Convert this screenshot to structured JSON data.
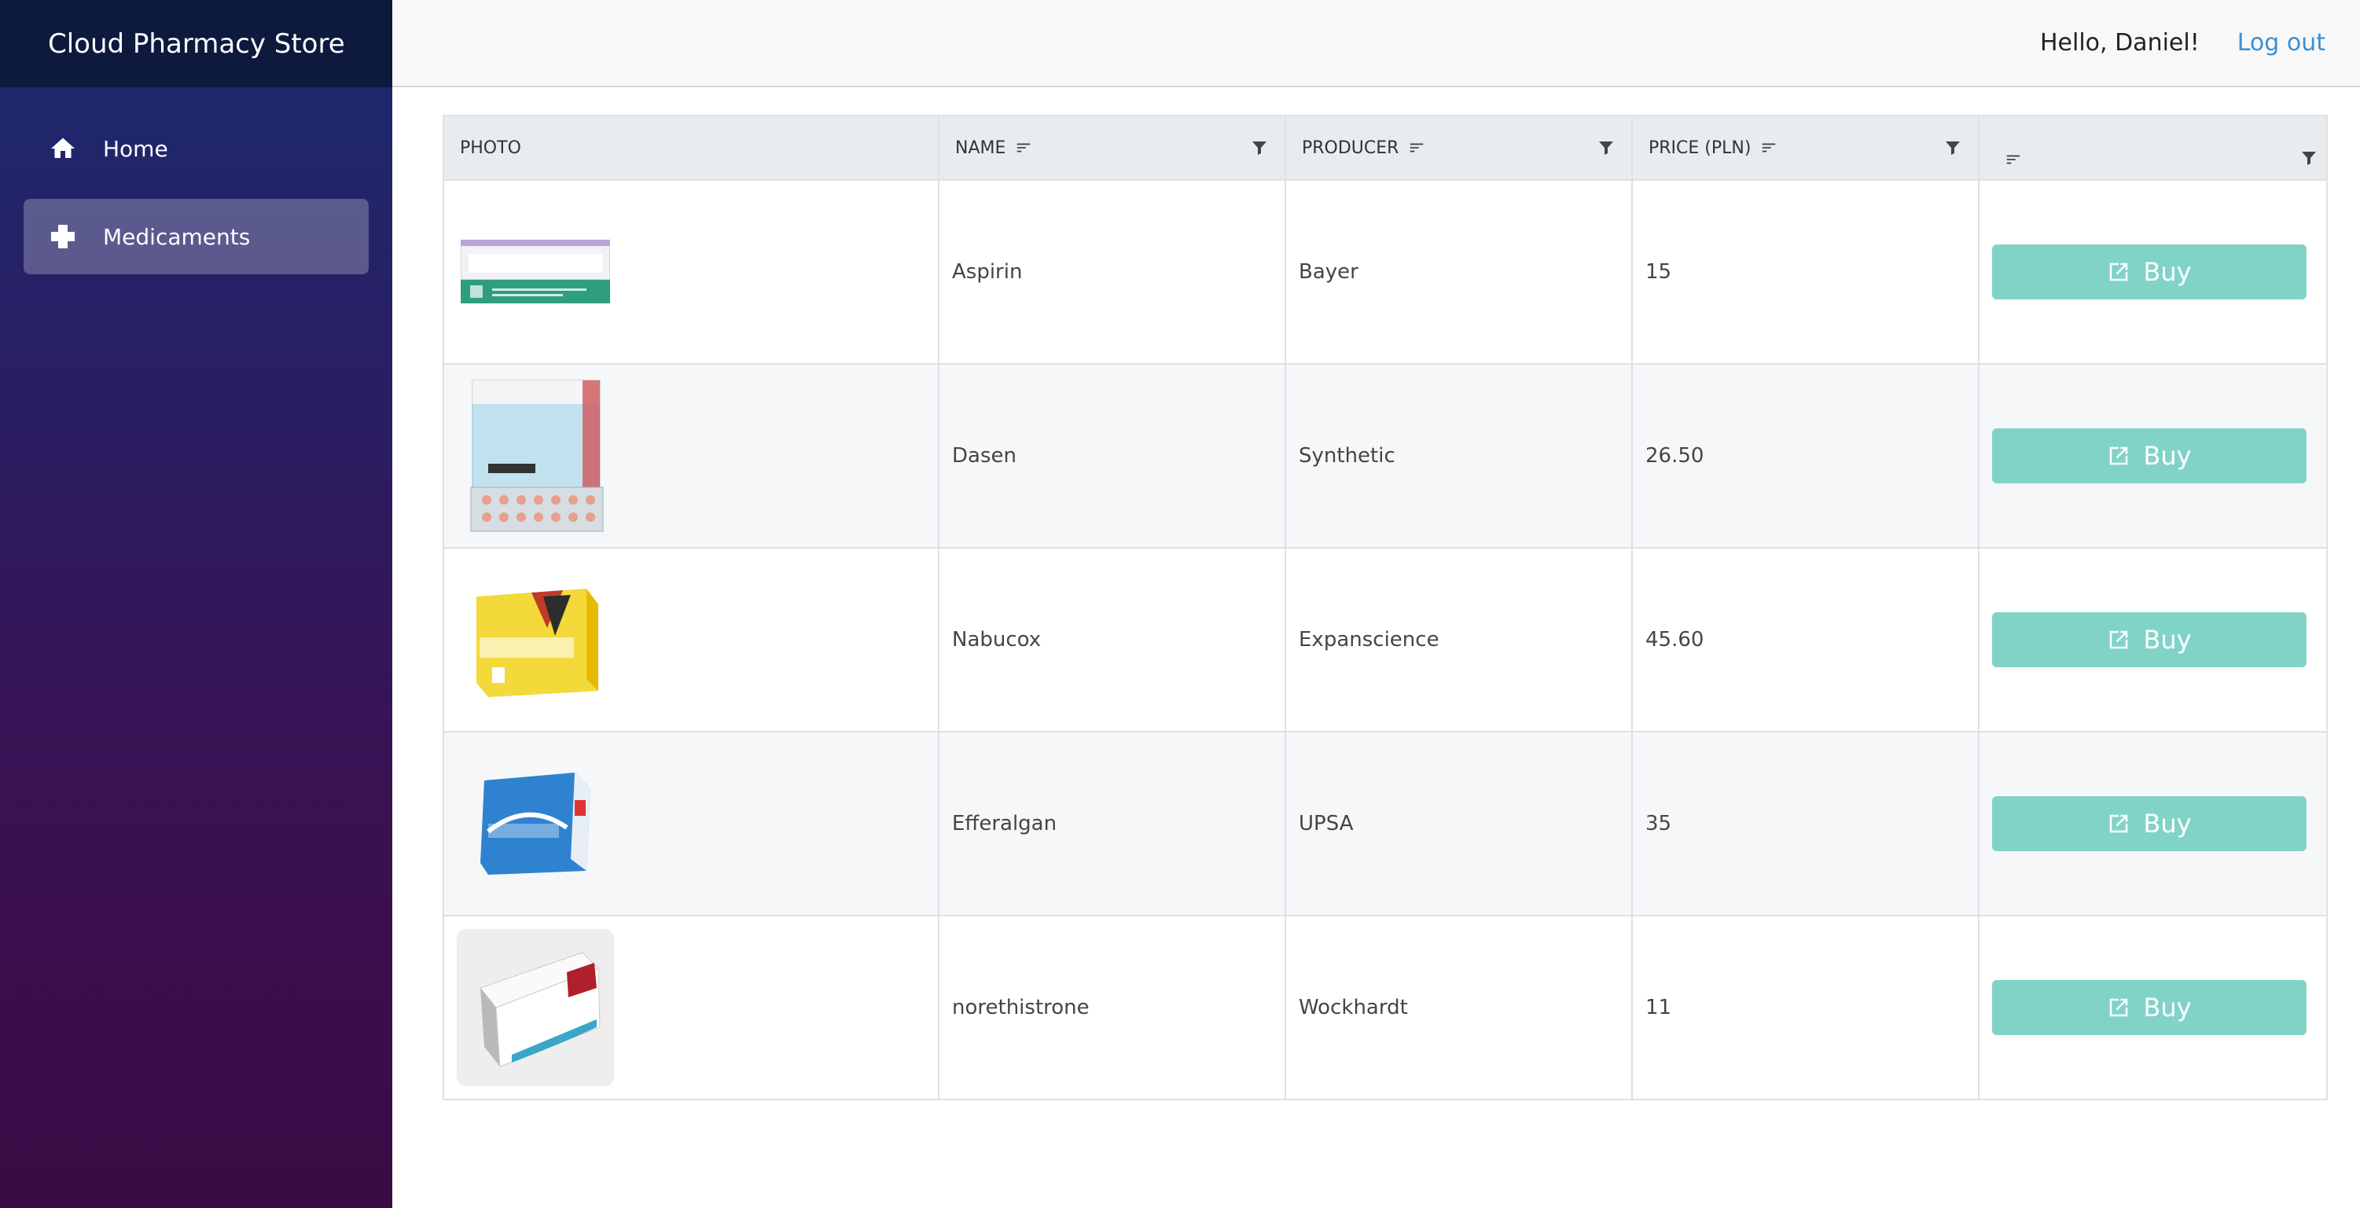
{
  "app": {
    "title": "Cloud Pharmacy Store"
  },
  "sidebar": {
    "items": [
      {
        "label": "Home",
        "icon": "home-icon",
        "active": false
      },
      {
        "label": "Medicaments",
        "icon": "medical-cross-icon",
        "active": true
      }
    ]
  },
  "header": {
    "greeting": "Hello, Daniel!",
    "logout": "Log out"
  },
  "table": {
    "columns": [
      "PHOTO",
      "NAME",
      "PRODUCER",
      "PRICE (PLN)",
      ""
    ],
    "buy_label": "Buy",
    "rows": [
      {
        "name": "Aspirin",
        "producer": "Bayer",
        "price": "15",
        "photo": "aspirin-package-image"
      },
      {
        "name": "Dasen",
        "producer": "Synthetic",
        "price": "26.50",
        "photo": "dasen-package-image"
      },
      {
        "name": "Nabucox",
        "producer": "Expanscience",
        "price": "45.60",
        "photo": "nabucox-package-image"
      },
      {
        "name": "Efferalgan",
        "producer": "UPSA",
        "price": "35",
        "photo": "efferalgan-package-image"
      },
      {
        "name": "norethistrone",
        "producer": "Wockhardt",
        "price": "11",
        "photo": "norethisterone-package-image"
      }
    ]
  },
  "colors": {
    "accent": "#81d3c8",
    "link": "#3b8fd4",
    "brand_bar": "#0d1a3e"
  }
}
